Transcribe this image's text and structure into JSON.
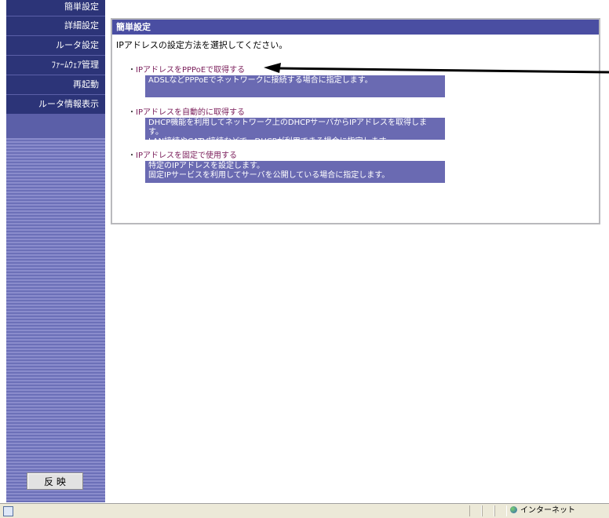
{
  "sidebar": {
    "items": [
      {
        "label": "簡単設定"
      },
      {
        "label": "詳細設定"
      },
      {
        "label": "ルータ設定"
      },
      {
        "label": "ﾌｧｰﾑｳｪｱ管理"
      },
      {
        "label": "再起動"
      },
      {
        "label": "ルータ情報表示"
      }
    ],
    "apply_label": "反 映"
  },
  "panel": {
    "title": "簡単設定",
    "instruction": "IPアドレスの設定方法を選択してください。",
    "options": [
      {
        "link": "IPアドレスをPPPoEで取得する",
        "desc": [
          "ADSLなどPPPoEでネットワークに接続する場合に指定します。"
        ]
      },
      {
        "link": "IPアドレスを自動的に取得する",
        "desc": [
          "DHCP機能を利用してネットワーク上のDHCPサーバからIPアドレスを取得します。",
          "LAN接続やCATV接続などで、DHCPが利用できる場合に指定します。"
        ]
      },
      {
        "link": "IPアドレスを固定で使用する",
        "desc": [
          "特定のIPアドレスを設定します。",
          "固定IPサービスを利用してサーバを公開している場合に指定します。"
        ]
      }
    ]
  },
  "statusbar": {
    "zone": "インターネット",
    "zone_icon": "globe-icon",
    "page_icon": "ie-page-icon"
  },
  "colors": {
    "sidebar_item": "#2c3478",
    "panel_title": "#4a4ea2",
    "desc_box": "#6a6ab2",
    "link": "#7a1d5a"
  }
}
